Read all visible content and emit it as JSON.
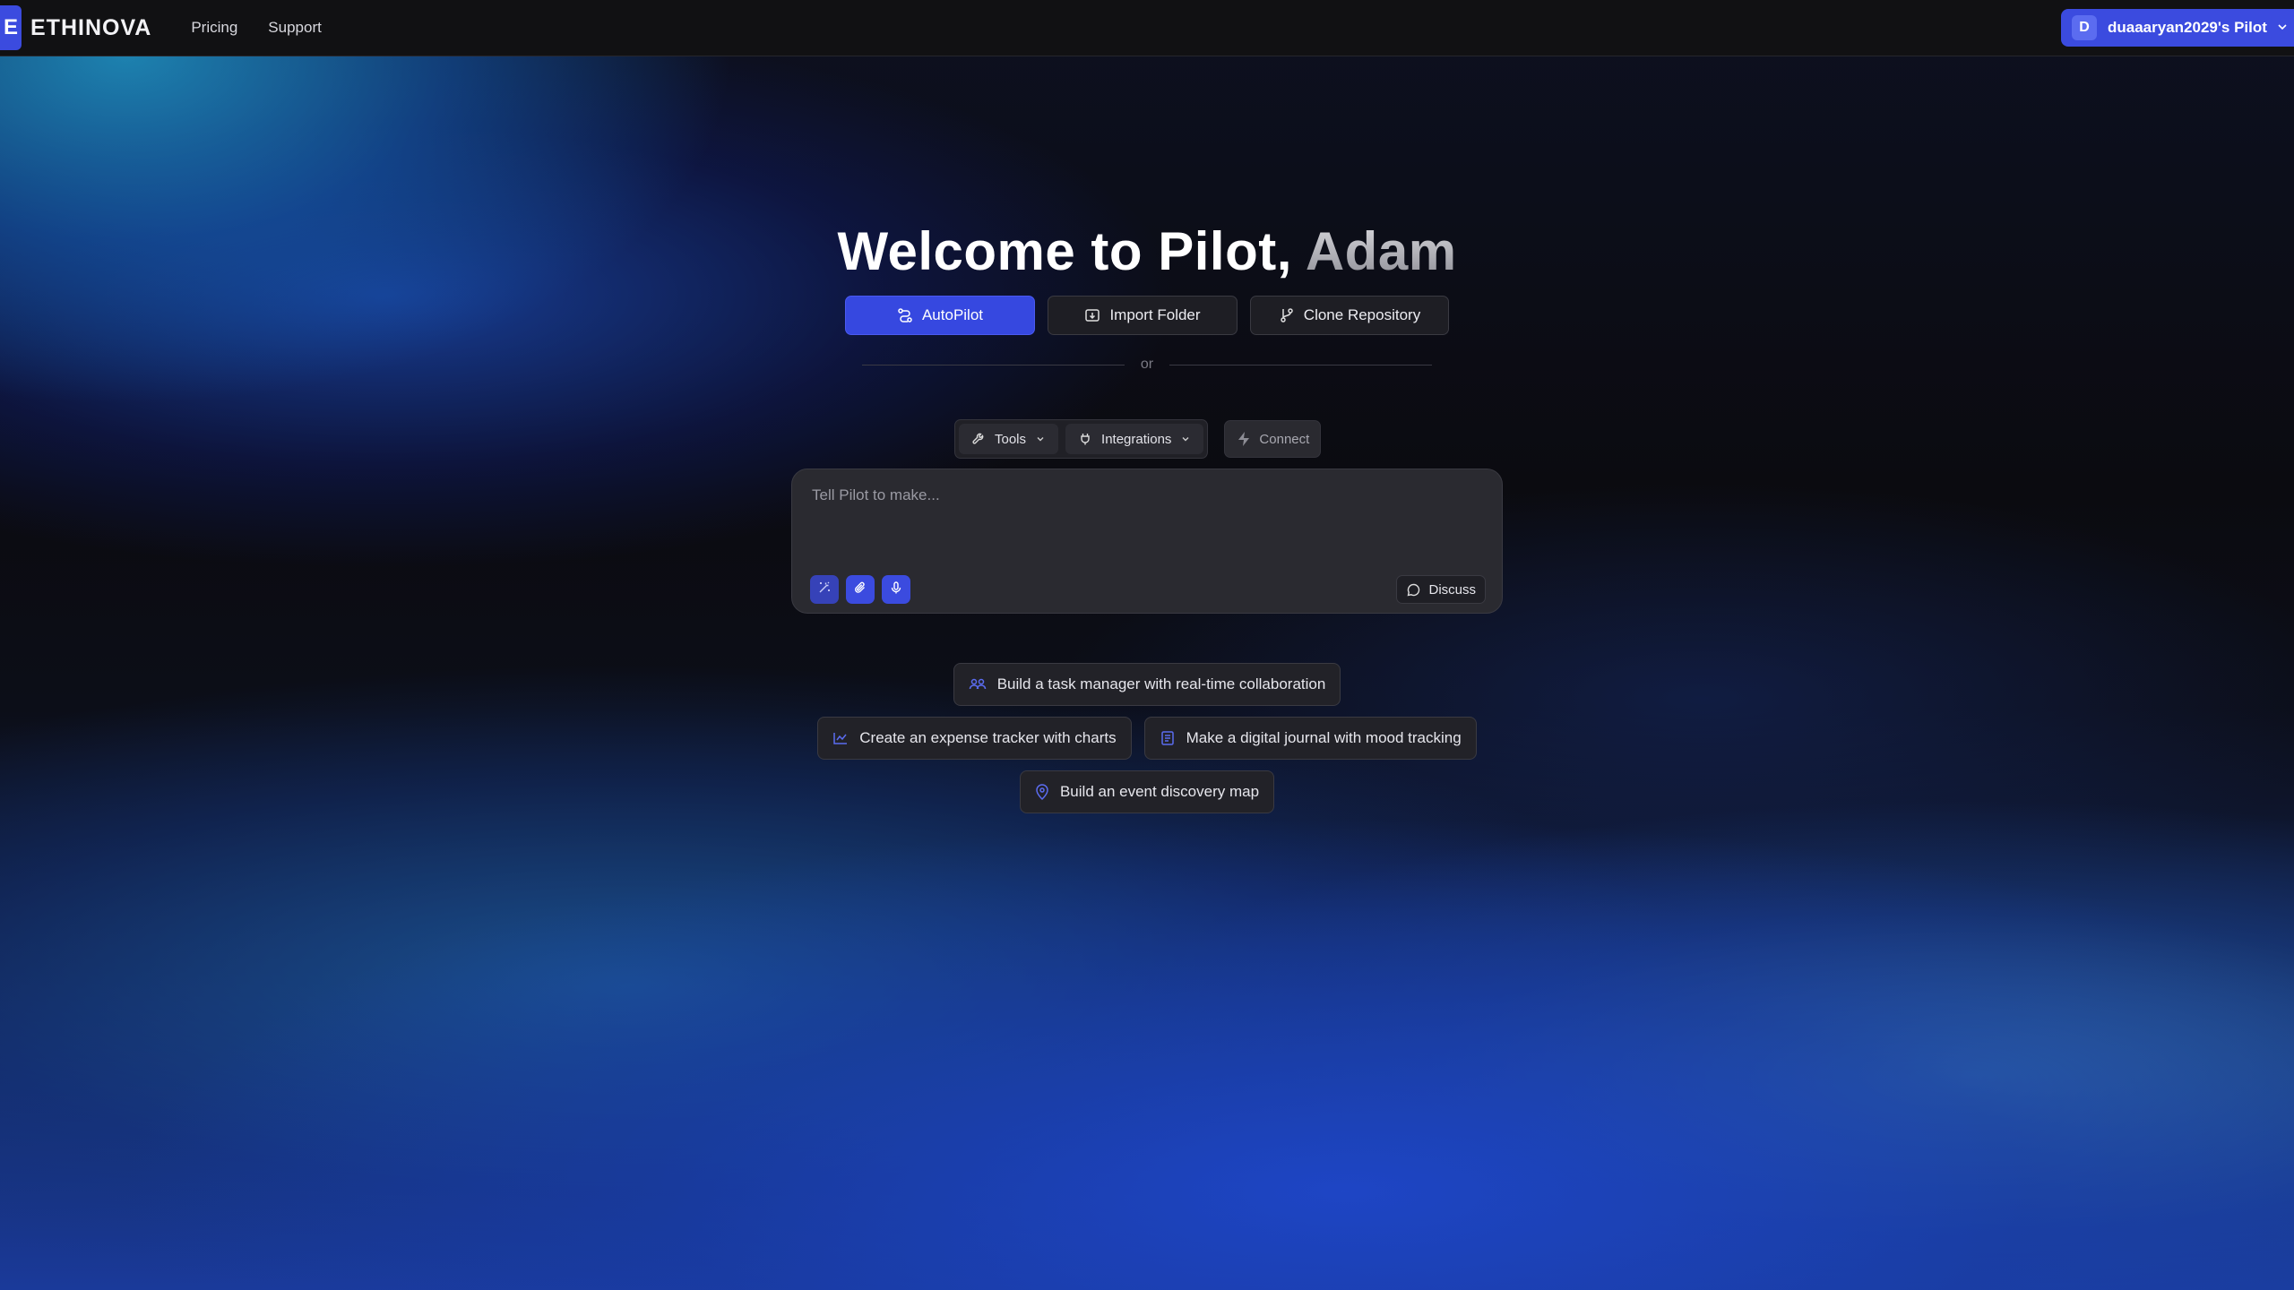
{
  "brand": {
    "mark": "E",
    "name": "ETHINOVA",
    "accent": "#3b4bdf"
  },
  "nav": {
    "pricing": "Pricing",
    "support": "Support"
  },
  "account": {
    "avatar_letter": "D",
    "label": "duaaaryan2029's Pilot"
  },
  "hero": {
    "title_prefix": "Welcome to Pilot, ",
    "title_name": "Adam"
  },
  "modes": {
    "autopilot": "AutoPilot",
    "import_folder": "Import Folder",
    "clone_repository": "Clone Repository"
  },
  "divider_text": "or",
  "toolbar": {
    "tools": "Tools",
    "integrations": "Integrations",
    "connect": "Connect"
  },
  "prompt": {
    "placeholder": "Tell Pilot to make...",
    "discuss": "Discuss"
  },
  "suggestions": {
    "task_manager": "Build a task manager with real-time collaboration",
    "expense_tracker": "Create an expense tracker with charts",
    "journal": "Make a digital journal with mood tracking",
    "event_map": "Build an event discovery map"
  }
}
